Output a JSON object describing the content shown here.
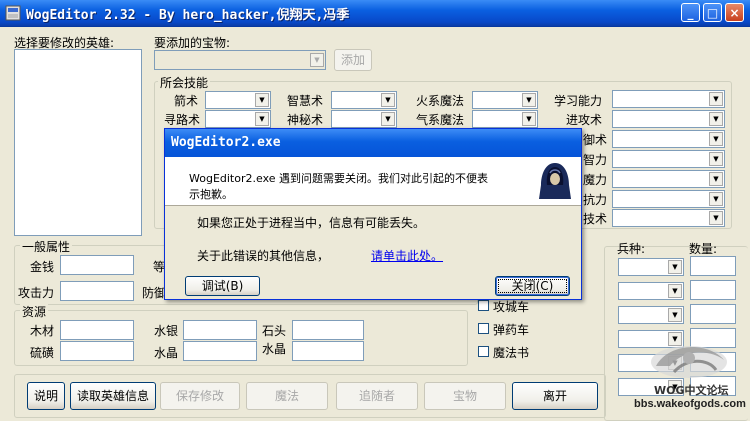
{
  "window": {
    "title": "WogEditor 2.32 - By  hero_hacker,倪翔天,冯季",
    "minimize_glyph": "_",
    "maximize_glyph": "□",
    "close_glyph": "×"
  },
  "hero_panel": {
    "label": "选择要修改的英雄:"
  },
  "treasure": {
    "label": "要添加的宝物:",
    "add_button": "添加"
  },
  "skills": {
    "group_label": "所会技能",
    "col1": [
      "箭术",
      "寻路术"
    ],
    "col2": [
      "智慧术",
      "神秘术"
    ],
    "col3": [
      "火系魔法",
      "气系魔法"
    ],
    "col4": [
      "学习能力",
      "进攻术"
    ],
    "col4_partial": [
      "御术",
      "智力",
      "魔力",
      "抗力",
      "技术"
    ]
  },
  "general": {
    "group_label": "一般属性",
    "money": "金钱",
    "attack": "攻击力",
    "cut1": "等",
    "cut2": "防御"
  },
  "resources": {
    "group_label": "资源",
    "wood": "木材",
    "sulfur": "硫磺",
    "mercury": "水银",
    "crystal": "水晶",
    "stone": "石头",
    "gems": "水晶"
  },
  "machines": {
    "cart": "攻城车",
    "ammo": "弹药车",
    "tent": "魔法书"
  },
  "troops": {
    "type_label": "兵种:",
    "count_label": "数量:"
  },
  "buttons": {
    "help": "说明",
    "read_hero": "读取英雄信息",
    "save": "保存修改",
    "magic": "魔法",
    "followers": "追随者",
    "treasure": "宝物",
    "exit": "离开"
  },
  "dialog": {
    "title": "WogEditor2.exe",
    "message_line1": "WogEditor2.exe 遇到问题需要关闭。我们对此引起的不便表",
    "message_line2": "示抱歉。",
    "warning": "如果您正处于进程当中，信息有可能丢失。",
    "info_prefix": "关于此错误的其他信息，",
    "info_link": "请单击此处。",
    "debug_button": "调试(B)",
    "close_button": "关闭(C)"
  },
  "watermark": {
    "line1": "WOG中文论坛",
    "line2": "bbs.wakeofgods.com"
  }
}
